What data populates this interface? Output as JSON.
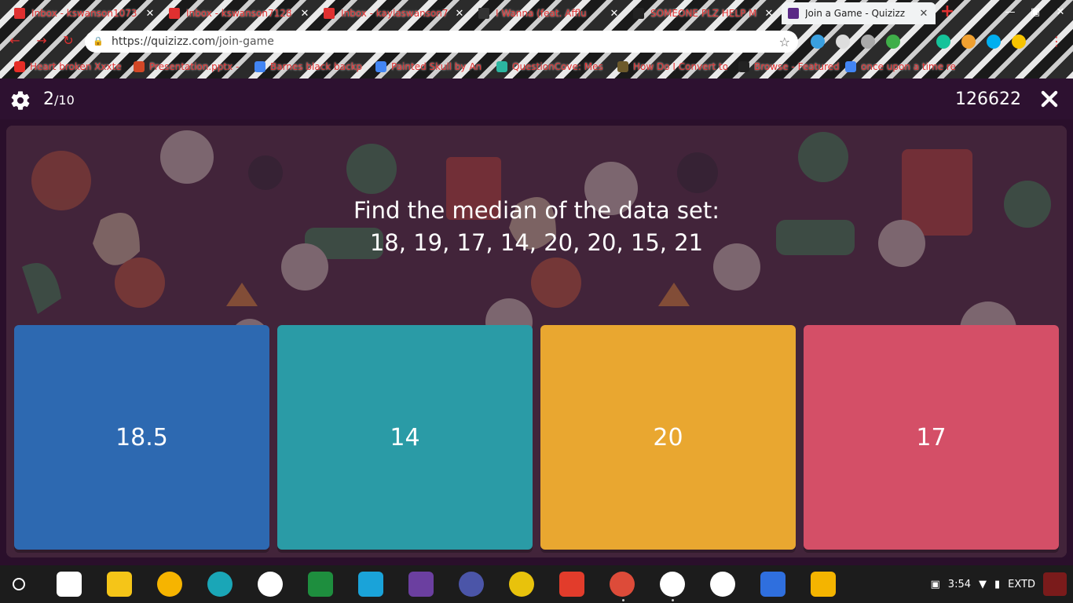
{
  "browser": {
    "tabs": [
      {
        "title": "Inbox - kswanson1073",
        "favicon": "gmail-icon",
        "active": false
      },
      {
        "title": "Inbox - kswanson7128",
        "favicon": "gmail-icon",
        "active": false
      },
      {
        "title": "Inbox - kaylaswanson7",
        "favicon": "gmail-icon",
        "active": false
      },
      {
        "title": "I Wanna (feat. Afflu",
        "favicon": "music-icon",
        "active": false
      },
      {
        "title": "SOMEONE PLZ HELP M",
        "favicon": "b-icon",
        "active": false
      },
      {
        "title": "Join a Game - Quizizz",
        "favicon": "quizizz-icon",
        "active": true
      }
    ],
    "address": {
      "domain": "https://quizizz.com",
      "path": "/join-game"
    },
    "bookmarks": [
      {
        "label": "Heart broken Xxxte",
        "favicon": "youtube-icon"
      },
      {
        "label": "Presentation.pptx -",
        "favicon": "powerpoint-icon"
      },
      {
        "label": "Barnes black backp",
        "favicon": "google-icon"
      },
      {
        "label": "Painted Skull by An",
        "favicon": "google-icon"
      },
      {
        "label": "QuestionCove: Mes",
        "favicon": "questioncove-icon"
      },
      {
        "label": "How Do I Convert to",
        "favicon": "co-icon"
      },
      {
        "label": "Browse - Featured",
        "favicon": "spotify-icon"
      },
      {
        "label": "once upon a time re",
        "favicon": "google-icon"
      }
    ]
  },
  "quiz": {
    "progress_current": "2",
    "progress_total": "/10",
    "game_code": "126622",
    "question_line1": "Find the median of the data set:",
    "question_line2": "18, 19, 17, 14, 20, 20, 15, 21",
    "options": [
      {
        "label": "18.5",
        "color": "#2d69b1"
      },
      {
        "label": "14",
        "color": "#2a9ba6"
      },
      {
        "label": "20",
        "color": "#e9a730"
      },
      {
        "label": "17",
        "color": "#d44f67"
      }
    ]
  },
  "shelf": {
    "time": "3:54",
    "keyboard": "EXTD",
    "apps": [
      {
        "name": "desmos-app",
        "color": "#ffffff"
      },
      {
        "name": "note-app",
        "color": "#f5c518"
      },
      {
        "name": "keep-app",
        "color": "#f6b400"
      },
      {
        "name": "droplet-app",
        "color": "#1aa6b7"
      },
      {
        "name": "drive-app",
        "color": "#ffffff"
      },
      {
        "name": "classroom-app",
        "color": "#1e8e3e"
      },
      {
        "name": "v3-app",
        "color": "#1aa3d9"
      },
      {
        "name": "onenote-app",
        "color": "#6b3fa0"
      },
      {
        "name": "e-app",
        "color": "#4b55a8"
      },
      {
        "name": "chip-app",
        "color": "#e8c20c"
      },
      {
        "name": "windows-app",
        "color": "#e23c2b"
      },
      {
        "name": "chrome-app",
        "color": "#dd4b39"
      },
      {
        "name": "gmail-app",
        "color": "#ffffff"
      },
      {
        "name": "webstore-app",
        "color": "#ffffff"
      },
      {
        "name": "docs-app",
        "color": "#2f6fde"
      },
      {
        "name": "slides-app",
        "color": "#f4b400"
      }
    ]
  }
}
